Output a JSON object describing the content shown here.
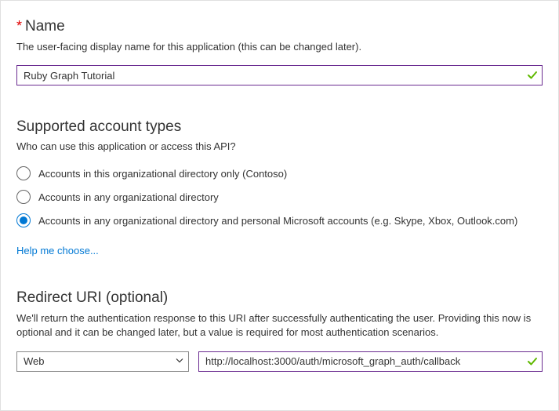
{
  "name_section": {
    "heading": "Name",
    "description": "The user-facing display name for this application (this can be changed later).",
    "value": "Ruby Graph Tutorial"
  },
  "account_types": {
    "heading": "Supported account types",
    "question": "Who can use this application or access this API?",
    "options": [
      {
        "label": "Accounts in this organizational directory only (Contoso)",
        "selected": false
      },
      {
        "label": "Accounts in any organizational directory",
        "selected": false
      },
      {
        "label": "Accounts in any organizational directory and personal Microsoft accounts (e.g. Skype, Xbox, Outlook.com)",
        "selected": true
      }
    ],
    "help_link": "Help me choose..."
  },
  "redirect_uri": {
    "heading": "Redirect URI (optional)",
    "description": "We'll return the authentication response to this URI after successfully authenticating the user. Providing this now is optional and it can be changed later, but a value is required for most authentication scenarios.",
    "type_selected": "Web",
    "value": "http://localhost:3000/auth/microsoft_graph_auth/callback"
  }
}
